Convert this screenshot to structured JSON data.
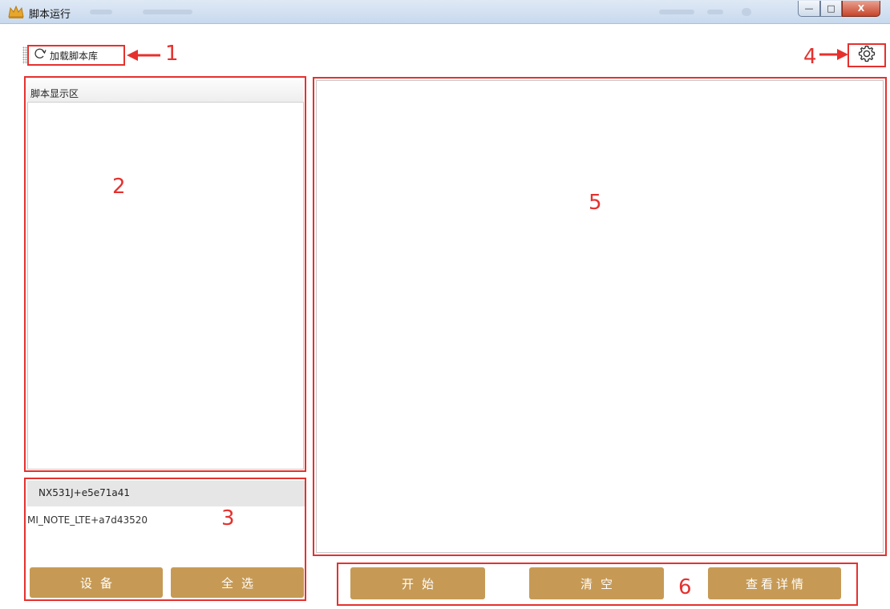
{
  "window": {
    "title": "脚本运行",
    "controls": {
      "minimize": "—",
      "maximize": "□",
      "close": "X"
    }
  },
  "toolbar": {
    "load_label": "加载脚本库",
    "load_icon": "refresh-icon",
    "settings_icon": "gear-icon"
  },
  "script_panel": {
    "header": "脚本显示区"
  },
  "devices": {
    "items": [
      "NX531J+e5e71a41",
      "MI_NOTE_LTE+a7d43520"
    ],
    "selected_index": 0,
    "device_button": "设备",
    "select_all_button": "全选"
  },
  "actions": {
    "start": "开始",
    "clear": "清空",
    "details": "查看详情"
  },
  "annotations": {
    "n1": "1",
    "n2": "2",
    "n3": "3",
    "n4": "4",
    "n5": "5",
    "n6": "6"
  },
  "colors": {
    "accent_button": "#c69a55",
    "annotation_red": "#e5312e",
    "title_bar": "#c8d9ee"
  }
}
